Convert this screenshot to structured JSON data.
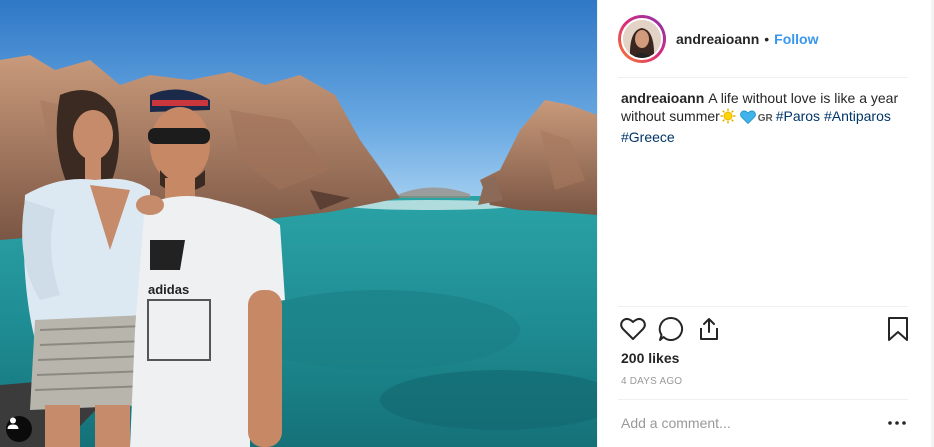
{
  "post": {
    "photo_alt": "Photo of a woman and a man standing on a boat in front of rocky cliffs and turquoise sea",
    "tag_icon": "person-tag-icon"
  },
  "header": {
    "username": "andreaioann",
    "separator": "•",
    "follow_label": "Follow",
    "avatar_icon": "profile-avatar"
  },
  "caption": {
    "username": "andreaioann",
    "text": "A life without love is like a year without summer",
    "emoji_sun": "sun-emoji",
    "emoji_heart": "blue-heart-emoji",
    "flag": "GR",
    "hashtags": [
      "#Paros",
      "#Antiparos",
      "#Greece"
    ]
  },
  "actions": {
    "like_icon": "heart-icon",
    "comment_icon": "comment-icon",
    "share_icon": "share-icon",
    "save_icon": "bookmark-icon"
  },
  "likes": "200 likes",
  "date": "4 DAYS AGO",
  "comment": {
    "placeholder": "Add a comment...",
    "value": "",
    "more_icon": "more-options-icon"
  },
  "colors": {
    "follow": "#3897f0",
    "hashtag": "#003569",
    "divider": "#efefef",
    "muted": "#999999"
  }
}
